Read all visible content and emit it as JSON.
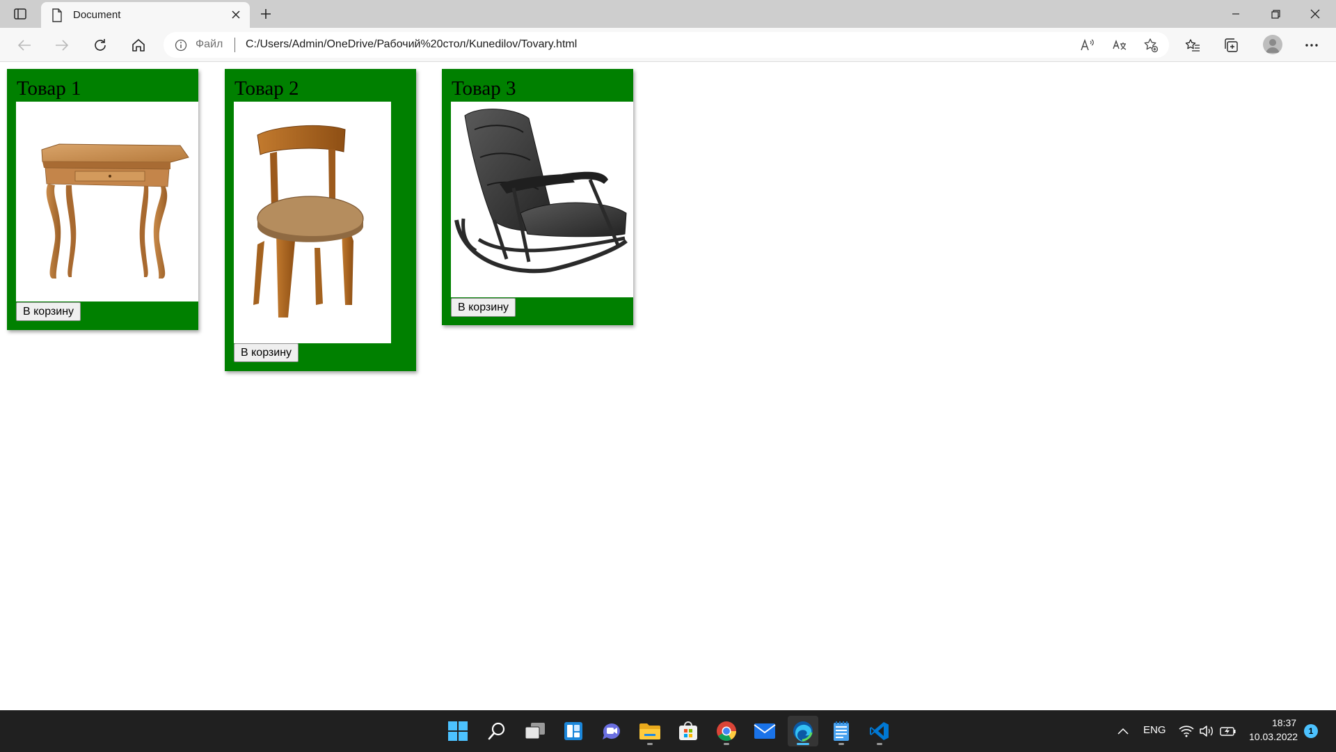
{
  "browser": {
    "tab_title": "Document",
    "address_scheme_label": "Файл",
    "url": "C:/Users/Admin/OneDrive/Рабочий%20стол/Kunedilov/Tovary.html"
  },
  "products": [
    {
      "title": "Товар 1",
      "button_label": "В корзину",
      "image": "wooden-table"
    },
    {
      "title": "Товар 2",
      "button_label": "В корзину",
      "image": "wooden-chair"
    },
    {
      "title": "Товар 3",
      "button_label": "В корзину",
      "image": "rocking-chair"
    }
  ],
  "taskbar": {
    "language": "ENG",
    "time": "18:37",
    "date": "10.03.2022",
    "notification_count": "1",
    "apps": [
      "start",
      "search",
      "task-view",
      "widgets",
      "teams-chat",
      "file-explorer",
      "microsoft-store",
      "chrome",
      "mail",
      "edge",
      "notepad",
      "vs-code"
    ]
  },
  "colors": {
    "card_background": "#008000",
    "taskbar": "#202020",
    "accent": "#4cc2ff"
  }
}
